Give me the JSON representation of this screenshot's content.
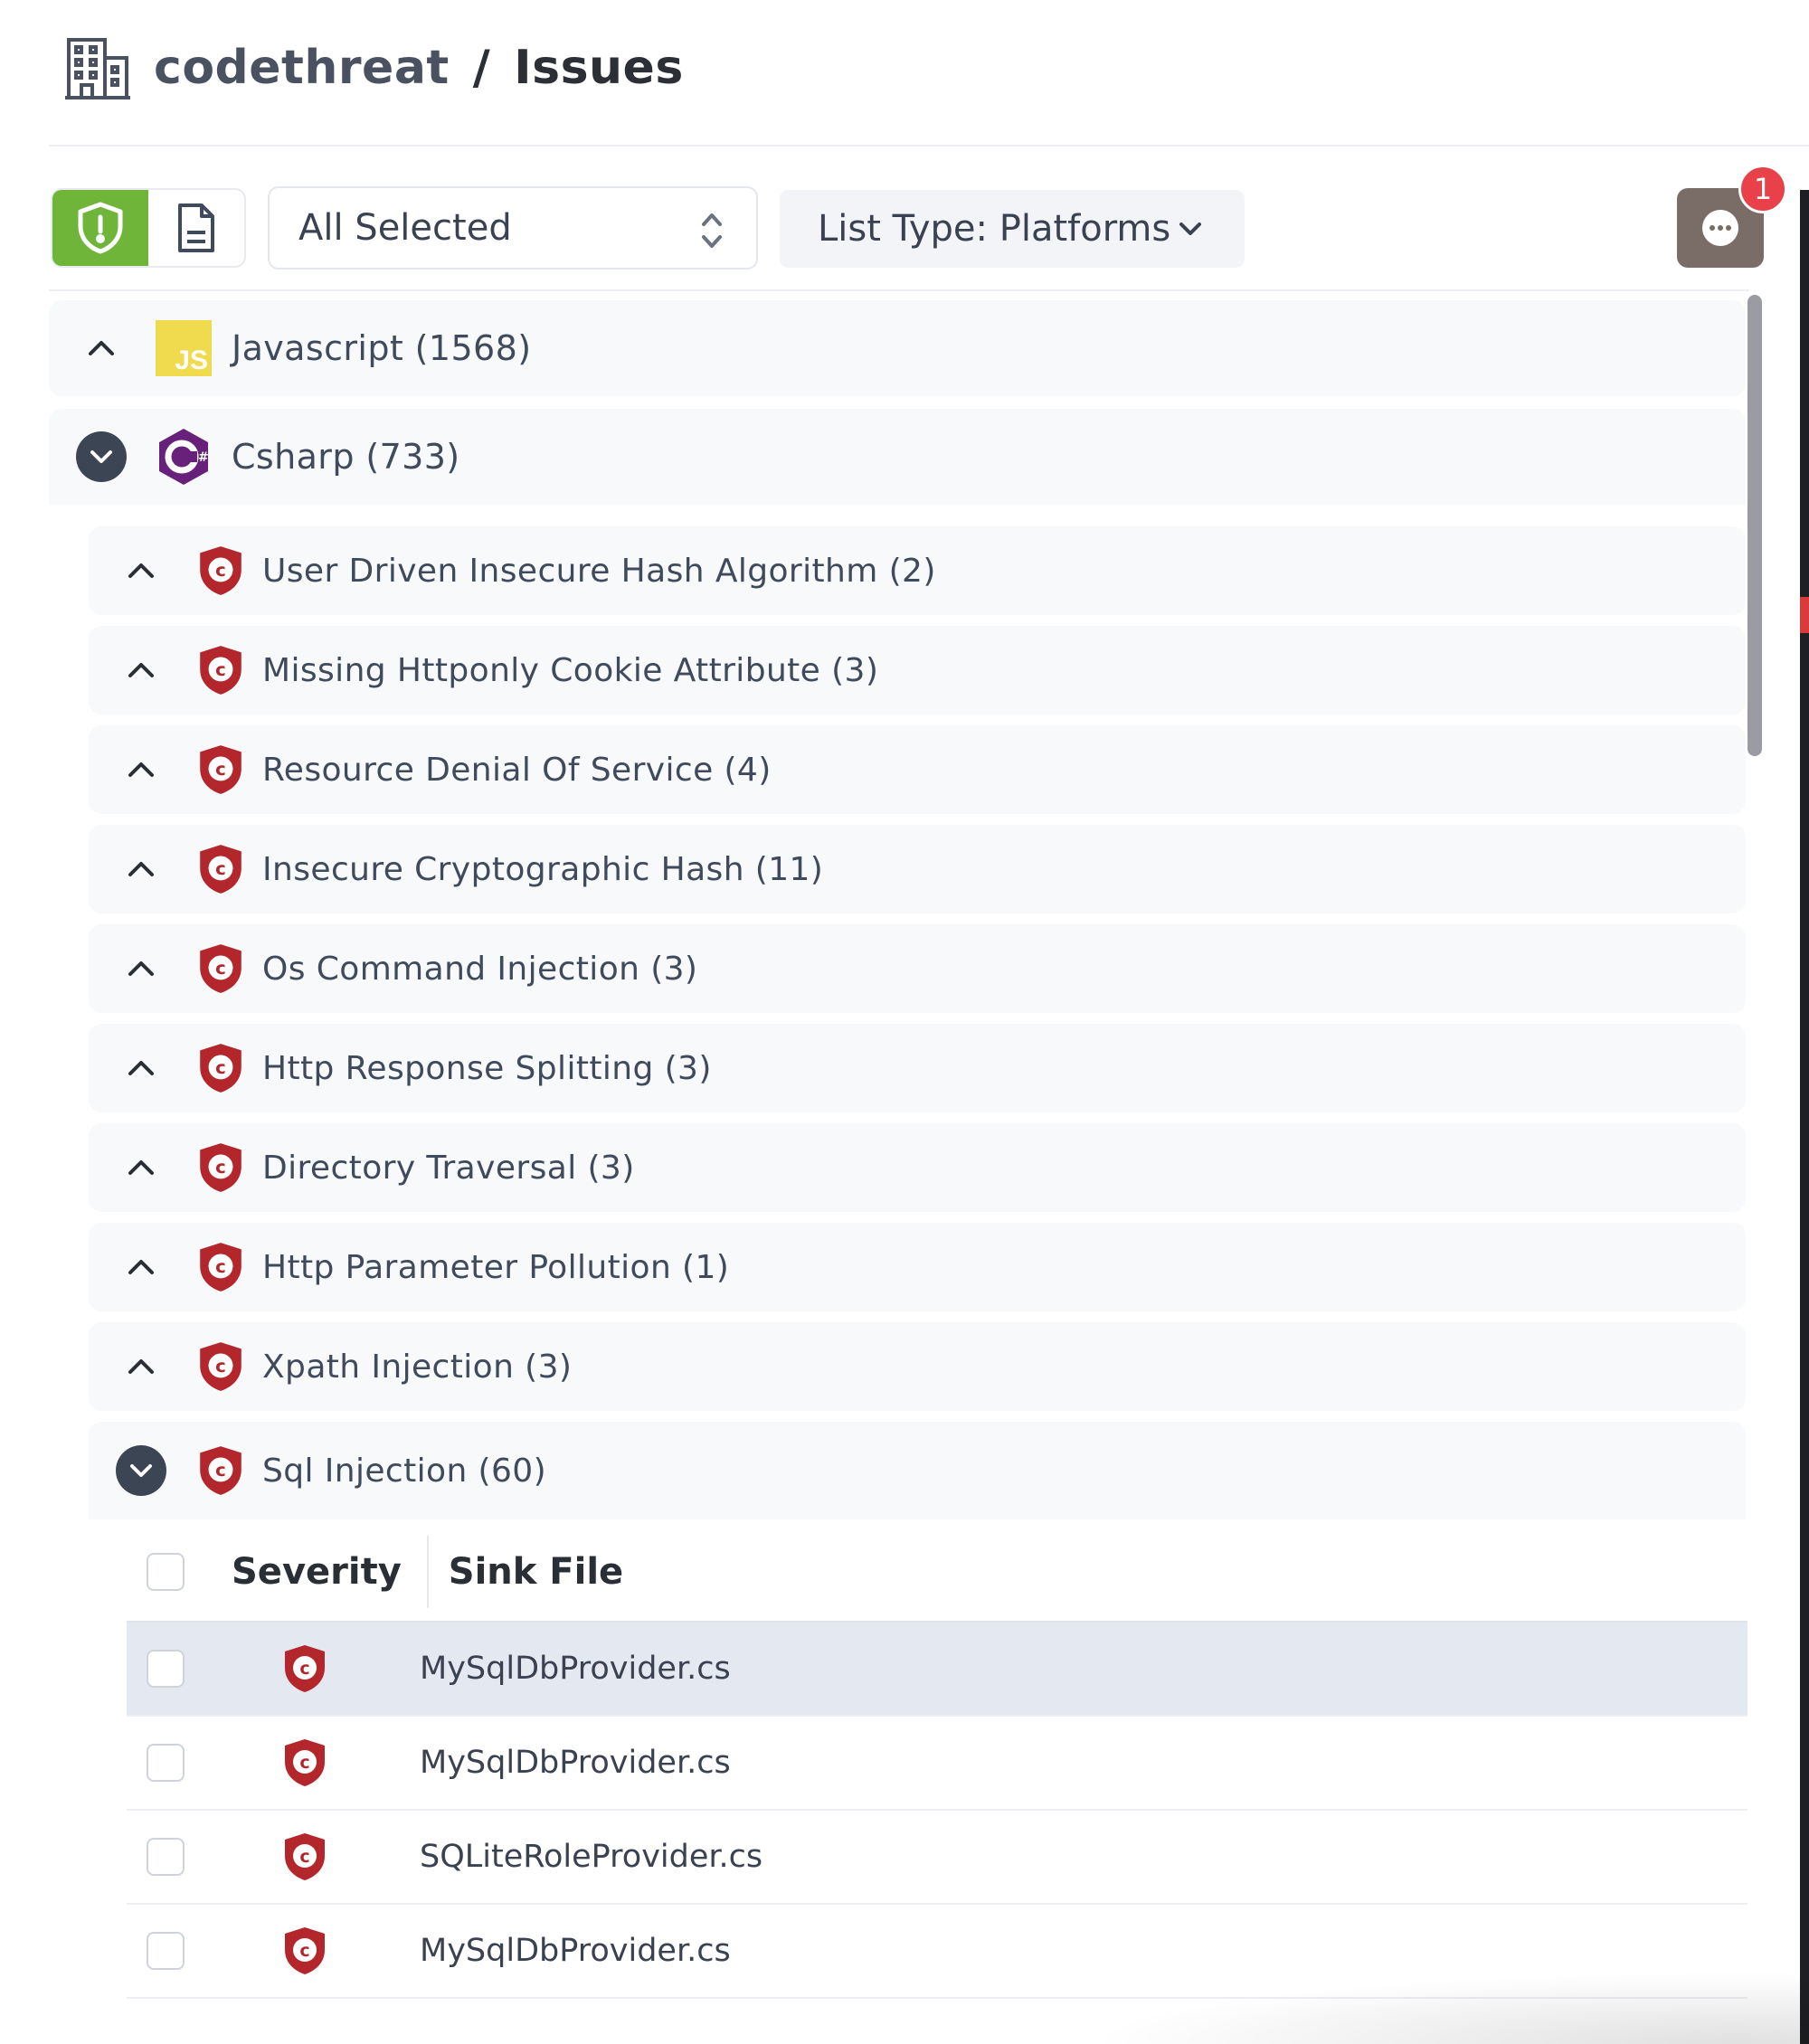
{
  "header": {
    "org": "codethreat",
    "separator": "/",
    "page": "Issues"
  },
  "toolbar": {
    "select_value": "All Selected",
    "list_type": "List Type: Platforms",
    "notification_count": "1"
  },
  "platforms": [
    {
      "label": "Javascript",
      "count": "(1568)",
      "expanded": false,
      "icon": "js-icon"
    },
    {
      "label": "Csharp",
      "count": "(733)",
      "expanded": true,
      "icon": "csharp-icon"
    }
  ],
  "issues": [
    {
      "label": "User Driven Insecure Hash Algorithm",
      "count": "(2)",
      "expanded": false
    },
    {
      "label": "Missing Httponly Cookie Attribute",
      "count": "(3)",
      "expanded": false
    },
    {
      "label": "Resource Denial Of Service",
      "count": "(4)",
      "expanded": false
    },
    {
      "label": "Insecure Cryptographic Hash",
      "count": "(11)",
      "expanded": false
    },
    {
      "label": "Os Command Injection",
      "count": "(3)",
      "expanded": false
    },
    {
      "label": "Http Response Splitting",
      "count": "(3)",
      "expanded": false
    },
    {
      "label": "Directory Traversal",
      "count": "(3)",
      "expanded": false
    },
    {
      "label": "Http Parameter Pollution",
      "count": "(1)",
      "expanded": false
    },
    {
      "label": "Xpath Injection",
      "count": "(3)",
      "expanded": false
    },
    {
      "label": "Sql Injection",
      "count": "(60)",
      "expanded": true
    }
  ],
  "table": {
    "headers": {
      "severity": "Severity",
      "sink_file": "Sink File"
    },
    "rows": [
      {
        "severity": "critical",
        "sink_file": "MySqlDbProvider.cs",
        "selected": true
      },
      {
        "severity": "critical",
        "sink_file": "MySqlDbProvider.cs",
        "selected": false
      },
      {
        "severity": "critical",
        "sink_file": "SQLiteRoleProvider.cs",
        "selected": false
      },
      {
        "severity": "critical",
        "sink_file": "MySqlDbProvider.cs",
        "selected": false
      }
    ]
  },
  "colors": {
    "accent_green": "#6fb53a",
    "critical_red": "#b3262b",
    "csharp_purple": "#68217a",
    "js_yellow": "#f0db4f",
    "badge_red": "#e8414a"
  }
}
